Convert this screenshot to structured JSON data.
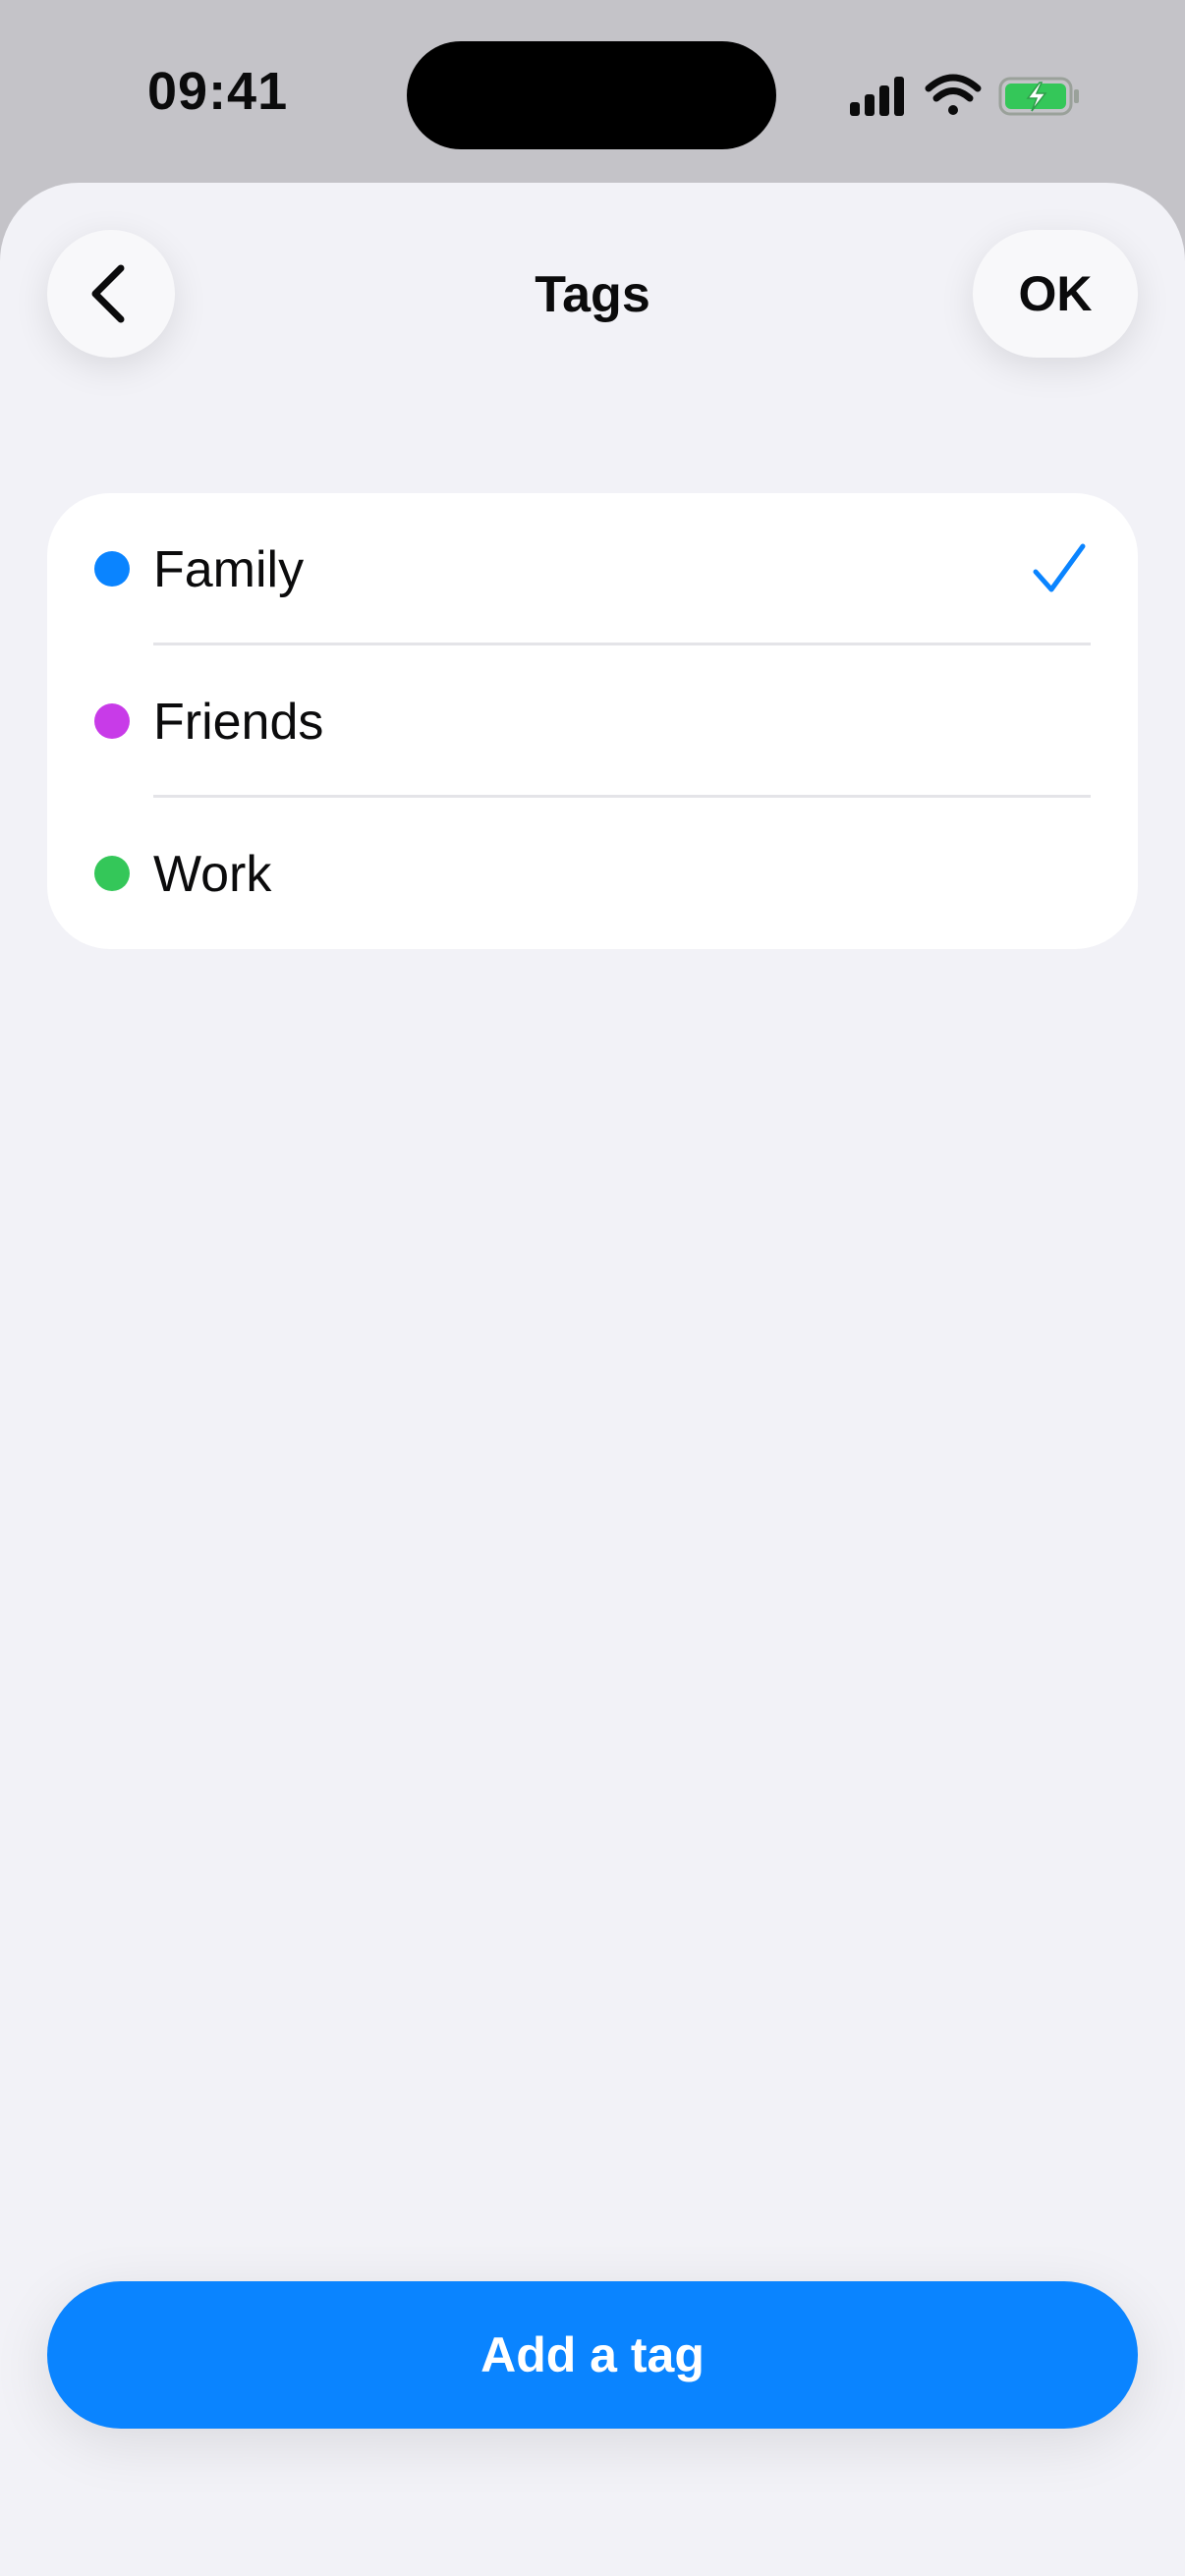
{
  "status_bar": {
    "time": "09:41",
    "icons": [
      "cellular-signal-icon",
      "wifi-icon",
      "battery-charging-icon"
    ]
  },
  "sheet": {
    "title": "Tags",
    "back_icon": "chevron-left-icon",
    "ok_label": "OK"
  },
  "tags": [
    {
      "label": "Family",
      "color": "#0a84ff",
      "selected": true
    },
    {
      "label": "Friends",
      "color": "#c83be8",
      "selected": false
    },
    {
      "label": "Work",
      "color": "#34c759",
      "selected": false
    }
  ],
  "colors": {
    "accent": "#0a84ff",
    "sheet_background": "#f2f2f7",
    "battery_fill": "#34c759"
  },
  "footer": {
    "add_label": "Add a tag"
  }
}
